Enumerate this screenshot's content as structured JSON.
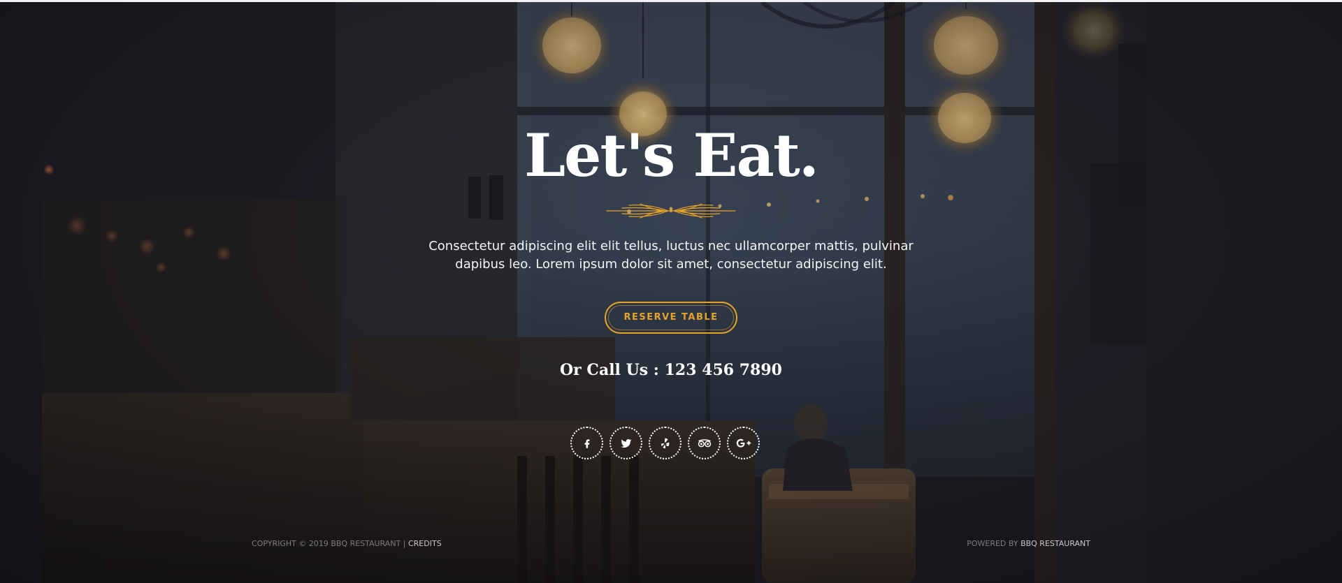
{
  "hero": {
    "title": "Let's Eat.",
    "intro_line1": "Consectetur adipiscing elit elit tellus, luctus nec ullamcorper mattis, pulvinar",
    "intro_line2": "dapibus leo. Lorem ipsum dolor sit amet, consectetur adipiscing elit.",
    "reserve_label": "RESERVE TABLE",
    "call_text": "Or Call Us : 123 456 7890"
  },
  "social": {
    "icons": [
      "facebook-icon",
      "twitter-icon",
      "yelp-icon",
      "tripadvisor-icon",
      "google-plus-icon"
    ]
  },
  "footer": {
    "copyright_text": "COPYRIGHT © 2019 BBQ RESTAURANT |",
    "credits_label": "CREDITS",
    "powered_text": "POWERED BY",
    "powered_brand": "BBQ RESTAURANT"
  },
  "colors": {
    "accent": "#e7a229",
    "text": "#ffffff",
    "footer_muted": "#7d7b80",
    "background": "#17161c"
  }
}
